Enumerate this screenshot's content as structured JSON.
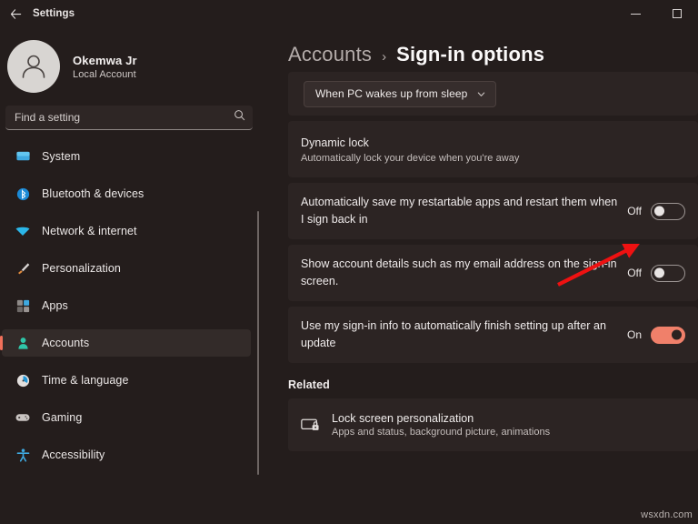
{
  "window": {
    "title": "Settings",
    "back_icon": "back-arrow-icon",
    "minimize_label": "Minimize",
    "maximize_label": "Maximize"
  },
  "sidebar": {
    "profile": {
      "name": "Okemwa Jr",
      "account_type": "Local Account",
      "avatar_icon": "person-avatar-icon"
    },
    "search": {
      "placeholder": "Find a setting",
      "value": "",
      "icon": "search-icon"
    },
    "items": [
      {
        "label": "System",
        "icon": "system-icon",
        "active": false
      },
      {
        "label": "Bluetooth & devices",
        "icon": "bluetooth-icon",
        "active": false
      },
      {
        "label": "Network & internet",
        "icon": "wifi-icon",
        "active": false
      },
      {
        "label": "Personalization",
        "icon": "paintbrush-icon",
        "active": false
      },
      {
        "label": "Apps",
        "icon": "apps-icon",
        "active": false
      },
      {
        "label": "Accounts",
        "icon": "accounts-person-icon",
        "active": true
      },
      {
        "label": "Time & language",
        "icon": "clock-icon",
        "active": false
      },
      {
        "label": "Gaming",
        "icon": "gamepad-icon",
        "active": false
      },
      {
        "label": "Accessibility",
        "icon": "accessibility-icon",
        "active": false
      }
    ]
  },
  "breadcrumb": {
    "parent": "Accounts",
    "separator": "›",
    "current": "Sign-in options"
  },
  "main": {
    "dropdown": {
      "value": "When PC wakes up from sleep",
      "chevron_icon": "chevron-down-icon"
    },
    "settings": [
      {
        "title": "Dynamic lock",
        "subtitle": "Automatically lock your device when you're away",
        "has_toggle": false
      },
      {
        "title": "Automatically save my restartable apps and restart them when I sign back in",
        "subtitle": "",
        "has_toggle": true,
        "toggle_state": "Off",
        "toggle_on": false
      },
      {
        "title": "Show account details such as my email address on the sign-in screen.",
        "subtitle": "",
        "has_toggle": true,
        "toggle_state": "Off",
        "toggle_on": false
      },
      {
        "title": "Use my sign-in info to automatically finish setting up after an update",
        "subtitle": "",
        "has_toggle": true,
        "toggle_state": "On",
        "toggle_on": true
      }
    ],
    "related": {
      "heading": "Related",
      "item": {
        "title": "Lock screen personalization",
        "subtitle": "Apps and status, background picture, animations",
        "icon": "lock-screen-icon"
      }
    }
  },
  "annotation": {
    "arrow_color": "#ee1111",
    "arrow_label": "red-pointer-arrow"
  },
  "watermark": {
    "text": "wsxdn.com"
  },
  "colors": {
    "background": "#241d1c",
    "card": "#2c2423",
    "accent": "#f0806a",
    "selection_bar": "#f1705a",
    "text_primary": "#f1eeed",
    "text_secondary": "#c6bfbd"
  }
}
